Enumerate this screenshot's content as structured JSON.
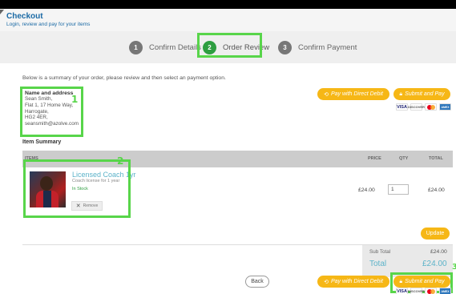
{
  "header": {
    "title": "Checkout",
    "subtitle": "Login, review and pay for your items"
  },
  "steps": [
    {
      "number": "1",
      "label": "Confirm Details",
      "active": false
    },
    {
      "number": "2",
      "label": "Order Review",
      "active": true
    },
    {
      "number": "3",
      "label": "Confirm Payment",
      "active": false
    }
  ],
  "intro": "Below is a summary of your order, please review and then select an payment option.",
  "address": {
    "title": "Name and address",
    "lines": [
      "Sean Smith,",
      "Flat 1, 17 Home Way,",
      "Harrogate,",
      "HG2 4ER,",
      "seansmith@azolve.com"
    ]
  },
  "payment": {
    "direct_debit_label": "Pay with Direct Debit",
    "submit_label": "Submit and Pay",
    "cards": [
      "VISA",
      "DISCOVER",
      "MasterCard",
      "AMEX"
    ]
  },
  "annotations": {
    "one": "1",
    "two": "2",
    "three": "3"
  },
  "item_summary": {
    "title": "Item Summary",
    "columns": [
      "ITEMS",
      "PRICE",
      "QTY",
      "TOTAL"
    ],
    "items": [
      {
        "name": "Licensed Coach 1yr",
        "description": "Coach license for 1 year",
        "stock": "In Stock",
        "remove_label": "Remove",
        "price": "£24.00",
        "qty": "1",
        "total": "£24.00"
      }
    ],
    "update_label": "Update"
  },
  "totals": {
    "subtotal_label": "Sub Total",
    "subtotal": "£24.00",
    "total_label": "Total",
    "total": "£24.00"
  },
  "back_label": "Back",
  "colors": {
    "accent": "#f6b716",
    "highlight": "#58d54a",
    "link": "#1b6aa5",
    "item_name": "#5cb3c9",
    "step_active": "#2e9e41"
  }
}
